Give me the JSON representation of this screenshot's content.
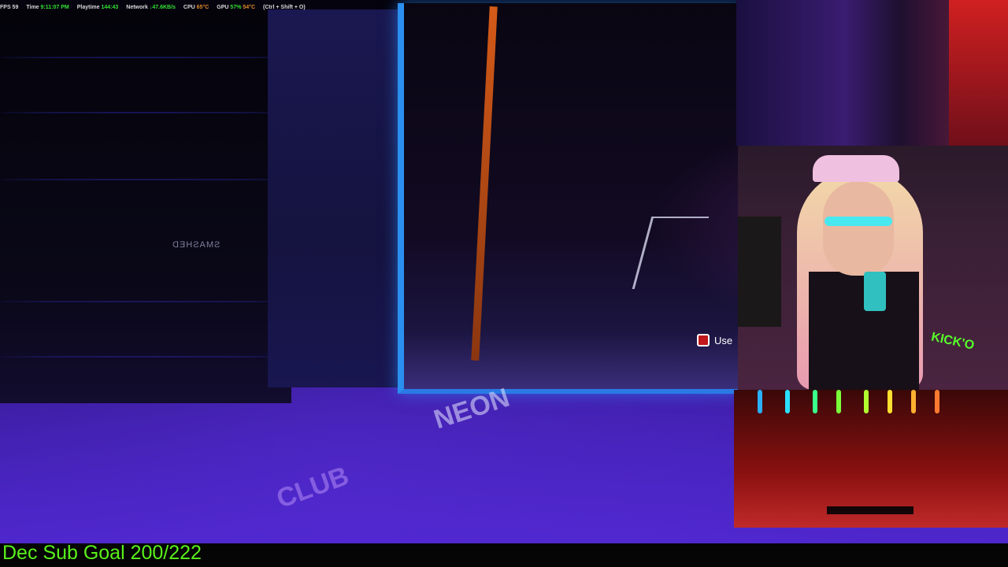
{
  "hud": {
    "fps": "FPS 59",
    "time_label": "Time",
    "time_value": "9:11:07 PM",
    "playtime_label": "Playtime",
    "playtime_value": "144:43",
    "network_label": "Network",
    "network_value": "↓47.6KB/s",
    "cpu_label": "CPU",
    "cpu_value": "65°C",
    "gpu_label": "GPU",
    "gpu_value": "57%",
    "gpu_temp": "54°C",
    "shortcut": "(Ctrl + Shift + O)"
  },
  "scene": {
    "sign_text": "SMASHED",
    "use_label": "Use",
    "floor_logo": "NEON",
    "floor_logo2": "CLUB"
  },
  "webcam": {
    "sponsor_text": "KICK'O"
  },
  "overlay": {
    "goal_text": "Dec Sub Goal 200/222"
  },
  "colors": {
    "screen_border": "#2b8ff0",
    "goal_text": "#59f01a",
    "hud_green": "#33e033",
    "hud_orange": "#e08a2a"
  }
}
